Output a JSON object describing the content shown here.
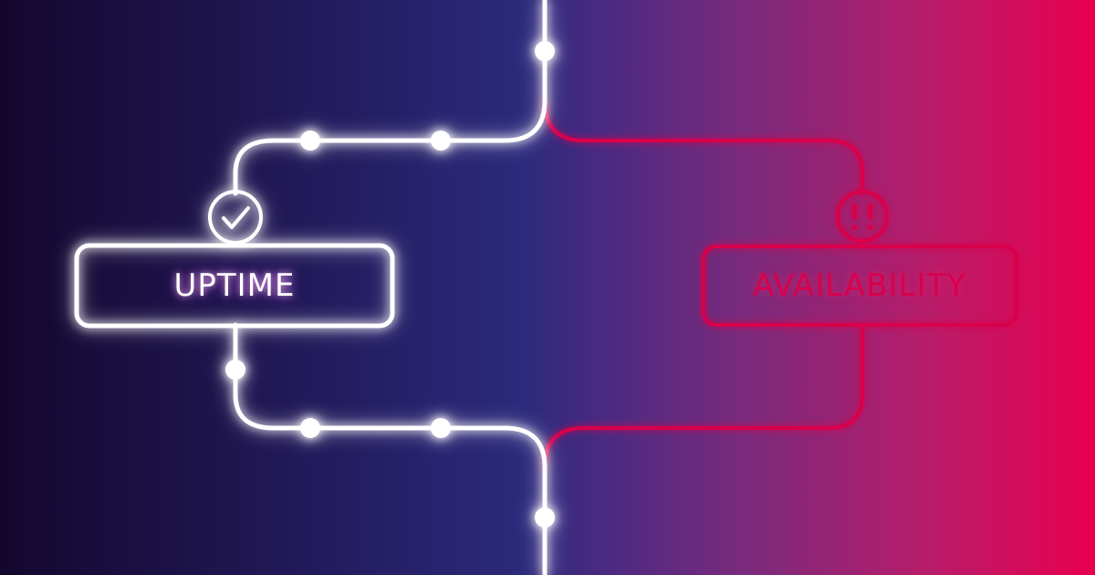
{
  "left_card": {
    "label": "UPTIME",
    "status_icon": "check-icon"
  },
  "right_card": {
    "label": "AVAILABILITY",
    "status_icon": "double-exclamation-icon"
  },
  "colors": {
    "gradient_left": "#14072e",
    "gradient_mid": "#2c2a7c",
    "gradient_right": "#e8004e",
    "line_white": "#ffffff",
    "glow_magenta": "#d050ff",
    "line_red": "#d8004c"
  }
}
